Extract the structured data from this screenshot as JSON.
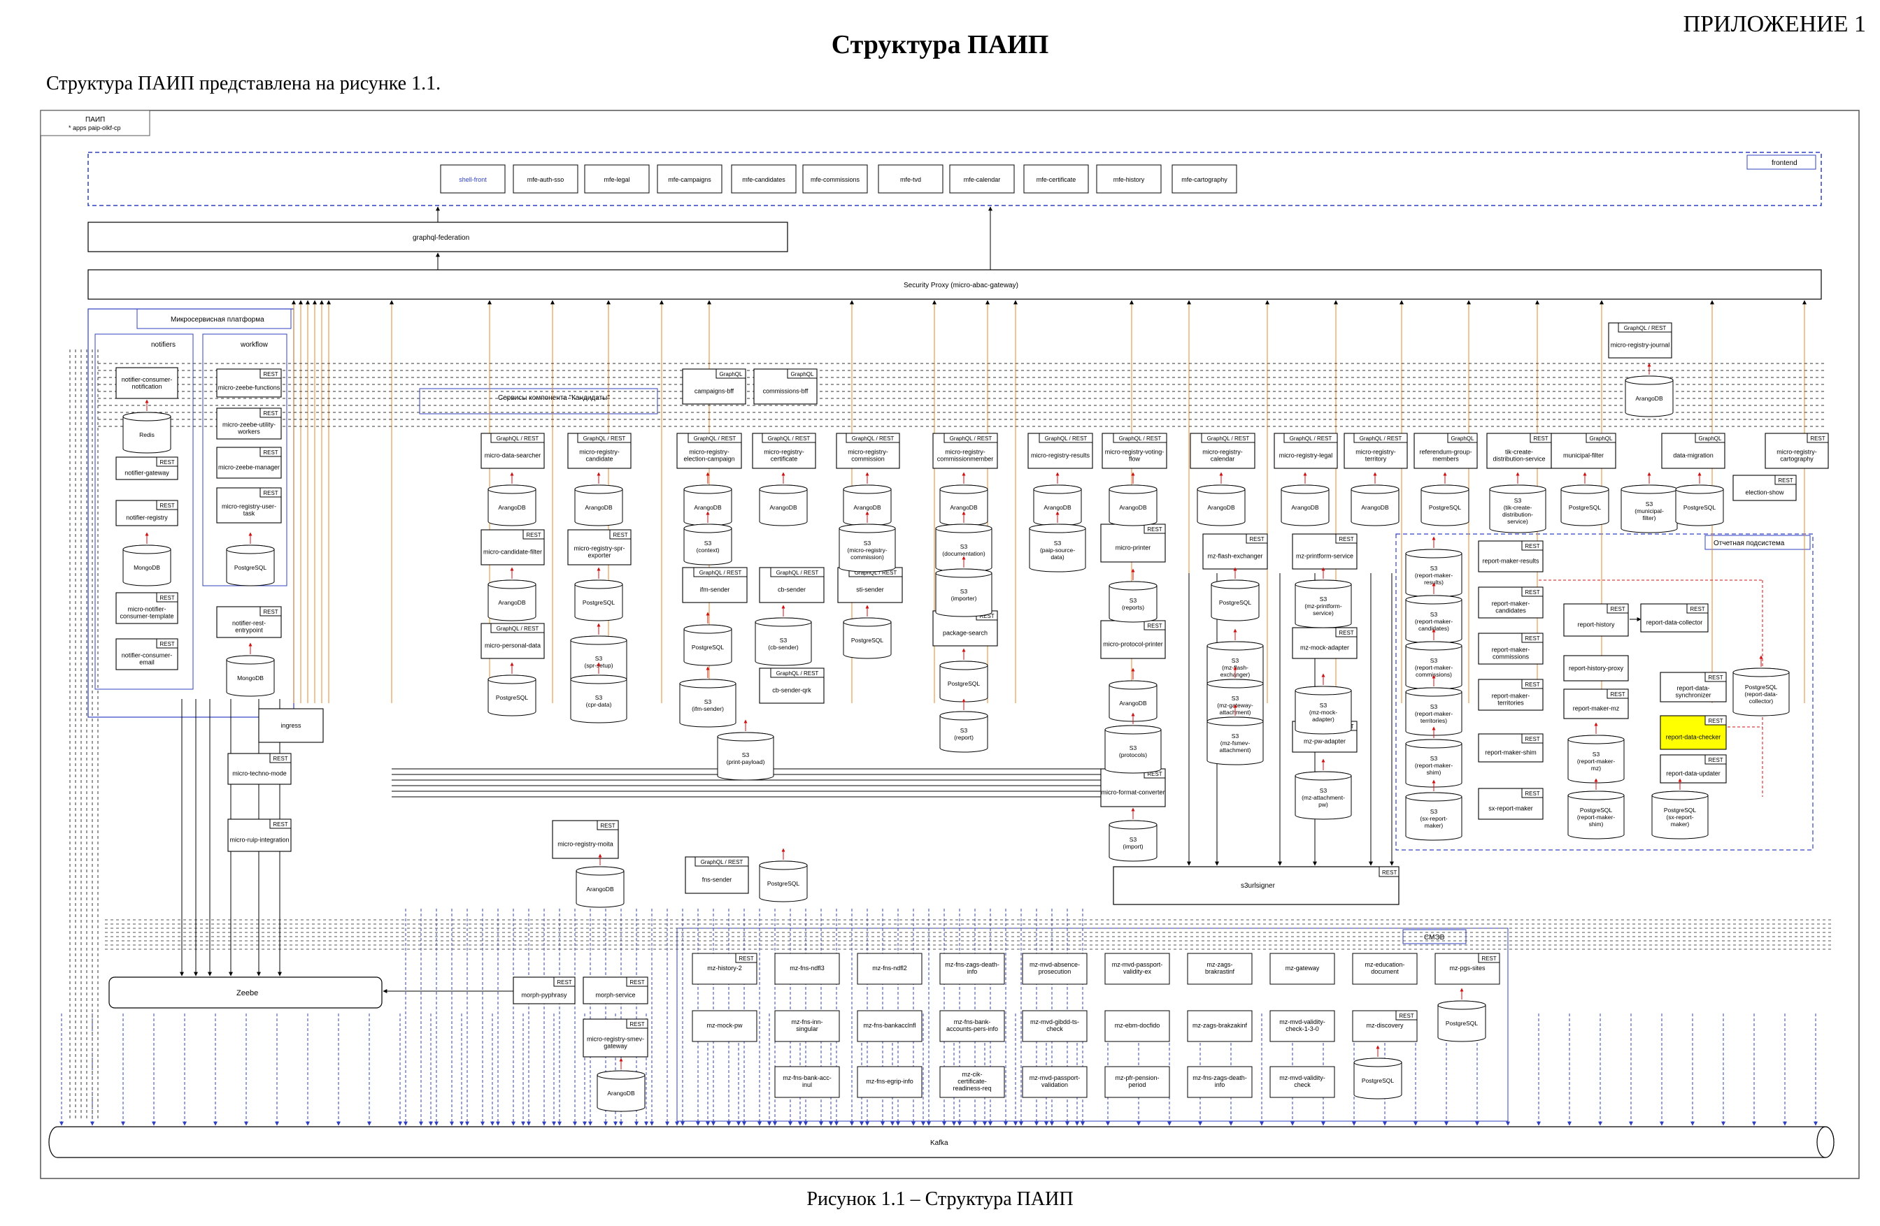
{
  "header": {
    "appendix": "ПРИЛОЖЕНИЕ 1",
    "title": "Структура ПАИП",
    "intro": "Структура ПАИП представлена на рисунке 1.1.",
    "caption": "Рисунок 1.1 – Структура ПАИП"
  },
  "diagram": {
    "corner": [
      "ПАИП",
      "* apps paip-olkf-cp"
    ],
    "frontend": {
      "label": "frontend",
      "apps": [
        "shell-front",
        "mfe-auth-sso",
        "mfe-legal",
        "mfe-campaigns",
        "mfe-candidates",
        "mfe-commissions",
        "mfe-tvd",
        "mfe-calendar",
        "mfe-certificate",
        "mfe-history",
        "mfe-cartography"
      ]
    },
    "federation": "graphql-federation",
    "security_proxy": "Security Proxy (micro-abac-gateway)",
    "platform_label": "Микросервисная платформа",
    "notifiers_label": "notifiers",
    "workflow_label": "workflow",
    "candidates_group_label": "Сервисы компонента \"Кандидаты\"",
    "reporting_label": "Отчетная подсистема",
    "smev_label": "СМЭВ",
    "kafka": "Kafka",
    "zeebe": "Zeebe",
    "s3urlsigner": "s3urlsigner",
    "services": [
      {
        "id": "notifier-consumer-notification",
        "label": "notifier-consumer-notification",
        "tag": ""
      },
      {
        "id": "notifier-gateway",
        "label": "notifier-gateway",
        "tag": "REST"
      },
      {
        "id": "notifier-registry",
        "label": "notifier-registry",
        "tag": "REST"
      },
      {
        "id": "micro-notifier-consumer-template",
        "label": "micro-notifier-consumer-template",
        "tag": "REST"
      },
      {
        "id": "notifier-consumer-email",
        "label": "notifier-consumer-email",
        "tag": "REST"
      },
      {
        "id": "micro-zeebe-functions",
        "label": "micro-zeebe-functions",
        "tag": "REST"
      },
      {
        "id": "micro-zeebe-utility-workers",
        "label": "micro-zeebe-utility-workers",
        "tag": "REST"
      },
      {
        "id": "micro-zeebe-manager",
        "label": "micro-zeebe-manager",
        "tag": "REST"
      },
      {
        "id": "micro-registry-user-task",
        "label": "micro-registry-user-task",
        "tag": "REST"
      },
      {
        "id": "notifier-rest-entrypoint",
        "label": "notifier-rest-entrypoint",
        "tag": "REST"
      },
      {
        "id": "ingress",
        "label": "ingress",
        "tag": ""
      },
      {
        "id": "micro-techno-mode",
        "label": "micro-techno-mode",
        "tag": "REST"
      },
      {
        "id": "micro-ruip-integration",
        "label": "micro-ruip-integration",
        "tag": "REST"
      },
      {
        "id": "campaigns-bff",
        "label": "campaigns-bff",
        "tag": "GraphQL"
      },
      {
        "id": "commissions-bff",
        "label": "commissions-bff",
        "tag": "GraphQL"
      },
      {
        "id": "micro-data-searcher",
        "label": "micro-data-searcher",
        "tag": "GraphQL / REST"
      },
      {
        "id": "micro-registry-candidate",
        "label": "micro-registry-candidate",
        "tag": "GraphQL / REST"
      },
      {
        "id": "micro-registry-election-campaign",
        "label": "micro-registry-election-campaign",
        "tag": "GraphQL / REST"
      },
      {
        "id": "micro-registry-certificate",
        "label": "micro-registry-certificate",
        "tag": "GraphQL / REST"
      },
      {
        "id": "micro-registry-commission",
        "label": "micro-registry-commission",
        "tag": "GraphQL / REST"
      },
      {
        "id": "micro-registry-commissionmember",
        "label": "micro-registry-commissionmember",
        "tag": "GraphQL / REST"
      },
      {
        "id": "micro-registry-results",
        "label": "micro-registry-results",
        "tag": "GraphQL / REST"
      },
      {
        "id": "micro-registry-voting-flow",
        "label": "micro-registry-voting-flow",
        "tag": "GraphQL / REST"
      },
      {
        "id": "micro-registry-calendar",
        "label": "micro-registry-calendar",
        "tag": "GraphQL / REST"
      },
      {
        "id": "micro-registry-legal",
        "label": "micro-registry-legal",
        "tag": "GraphQL / REST"
      },
      {
        "id": "micro-registry-territory",
        "label": "micro-registry-territory",
        "tag": "GraphQL / REST"
      },
      {
        "id": "referendum-group-members",
        "label": "referendum-group-members",
        "tag": "GraphQL"
      },
      {
        "id": "tik-create-distribution-service",
        "label": "tik-create-distribution-service",
        "tag": "REST"
      },
      {
        "id": "municipal-filter",
        "label": "municipal-filter",
        "tag": "GraphQL"
      },
      {
        "id": "data-migration",
        "label": "data-migration",
        "tag": "GraphQL"
      },
      {
        "id": "micro-registry-cartography",
        "label": "micro-registry-cartography",
        "tag": "REST"
      },
      {
        "id": "election-show",
        "label": "election-show",
        "tag": "REST"
      },
      {
        "id": "micro-registry-journal",
        "label": "micro-registry-journal",
        "tag": "GraphQL / REST"
      },
      {
        "id": "micro-candidate-filter",
        "label": "micro-candidate-filter",
        "tag": "REST"
      },
      {
        "id": "micro-registry-spr-exporter",
        "label": "micro-registry-spr-exporter",
        "tag": "REST"
      },
      {
        "id": "micro-personal-data",
        "label": "micro-personal-data",
        "tag": "GraphQL / REST"
      },
      {
        "id": "ifm-sender",
        "label": "ifm-sender",
        "tag": "GraphQL / REST"
      },
      {
        "id": "cb-sender",
        "label": "cb-sender",
        "tag": "GraphQL / REST"
      },
      {
        "id": "sti-sender",
        "label": "sti-sender",
        "tag": "GraphQL / REST"
      },
      {
        "id": "cb-sender-qrk",
        "label": "cb-sender-qrk",
        "tag": "GraphQL / REST"
      },
      {
        "id": "package-search",
        "label": "package-search",
        "tag": "REST"
      },
      {
        "id": "micro-printer",
        "label": "micro-printer",
        "tag": "REST"
      },
      {
        "id": "micro-protocol-printer",
        "label": "micro-protocol-printer",
        "tag": "REST"
      },
      {
        "id": "micro-format-converter",
        "label": "micro-format-converter",
        "tag": "REST"
      },
      {
        "id": "mz-flash-exchanger",
        "label": "mz-flash-exchanger",
        "tag": "REST"
      },
      {
        "id": "mz-printform-service",
        "label": "mz-printform-service",
        "tag": "REST"
      },
      {
        "id": "mz-mock-adapter",
        "label": "mz-mock-adapter",
        "tag": "REST"
      },
      {
        "id": "mz-pw-adapter",
        "label": "mz-pw-adapter",
        "tag": "REST"
      },
      {
        "id": "micro-registry-moita",
        "label": "micro-registry-moita",
        "tag": "REST"
      },
      {
        "id": "fns-sender",
        "label": "fns-sender",
        "tag": "GraphQL / REST"
      },
      {
        "id": "report-maker-results",
        "label": "report-maker-results",
        "tag": "REST"
      },
      {
        "id": "report-maker-candidates",
        "label": "report-maker-candidates",
        "tag": "REST"
      },
      {
        "id": "report-maker-commissions",
        "label": "report-maker-commissions",
        "tag": "REST"
      },
      {
        "id": "report-maker-territories",
        "label": "report-maker-territories",
        "tag": "REST"
      },
      {
        "id": "report-maker-shim",
        "label": "report-maker-shim",
        "tag": "REST"
      },
      {
        "id": "sx-report-maker",
        "label": "sx-report-maker",
        "tag": "REST"
      },
      {
        "id": "report-history",
        "label": "report-history",
        "tag": "REST"
      },
      {
        "id": "report-history-proxy",
        "label": "report-history-proxy",
        "tag": ""
      },
      {
        "id": "report-maker-mz",
        "label": "report-maker-mz",
        "tag": "REST"
      },
      {
        "id": "report-data-collector",
        "label": "report-data-collector",
        "tag": "REST"
      },
      {
        "id": "report-data-synchronizer",
        "label": "report-data-synchronizer",
        "tag": "REST"
      },
      {
        "id": "report-data-checker",
        "label": "report-data-checker",
        "tag": "REST"
      },
      {
        "id": "report-data-updater",
        "label": "report-data-updater",
        "tag": "REST"
      },
      {
        "id": "morph-pyphrasy",
        "label": "morph-pyphrasy",
        "tag": "REST"
      },
      {
        "id": "morph-service",
        "label": "morph-service",
        "tag": "REST"
      },
      {
        "id": "micro-registry-smev-gateway",
        "label": "micro-registry-smev-gateway",
        "tag": "REST"
      }
    ],
    "smev_services": [
      "mz-history-2",
      "mz-fns-ndfl3",
      "mz-fns-ndfl2",
      "mz-fns-zags-death-info",
      "mz-mvd-absence-prosecution",
      "mz-mvd-passport-validity-ex",
      "mz-zags-brakrastinf",
      "mz-gateway",
      "mz-education-document",
      "mz-pgs-sites",
      "mz-mock-pw",
      "mz-fns-inn-singular",
      "mz-fns-bankacclnfl",
      "mz-fns-bank-accounts-pers-info",
      "mz-mvd-gibdd-ts-check",
      "mz-ebm-docfido",
      "mz-zags-brakzakinf",
      "mz-mvd-validity-check-1-3-0",
      "mz-discovery",
      "mz-fns-bank-acc-inul",
      "mz-fns-egrip-info",
      "mz-cik-certificate-readiness-req",
      "mz-mvd-passport-validation",
      "mz-pfr-pension-period",
      "mz-fns-zags-death-info",
      "mz-mvd-validity-check"
    ],
    "storage": [
      "Redis",
      "MongoDB",
      "PostgreSQL",
      "MongoDB",
      "ArangoDB",
      "ArangoDB",
      "ArangoDB",
      "ArangoDB",
      "ArangoDB",
      "ArangoDB",
      "ArangoDB",
      "ArangoDB",
      "ArangoDB",
      "ArangoDB",
      "ArangoDB",
      "PostgreSQL",
      "S3 (tik-create-distribution-service)",
      "PostgreSQL",
      "S3 (municipal-filter)",
      "PostgreSQL",
      "ArangoDB",
      "S3 (context)",
      "S3 (micro-registry-commission)",
      "S3 (documentation)",
      "S3 (paip-source-data)",
      "S3 (importer)",
      "ArangoDB",
      "PostgreSQL",
      "S3 (spr-setup)",
      "S3 (cpr-data)",
      "PostgreSQL",
      "S3 (ifm-sender)",
      "S3 (cb-sender)",
      "PostgreSQL",
      "PostgreSQL",
      "S3 (print-payload)",
      "PostgreSQL",
      "S3 (report)",
      "S3 (reports)",
      "ArangoDB",
      "S3 (protocols)",
      "S3 (import)",
      "PostgreSQL",
      "S3 (mz-flash-exchanger)",
      "S3 (mz-gateway-attachment)",
      "S3 (mz-fsmev-attachment)",
      "S3 (mz-printform-service)",
      "S3 (mz-mock-adapter)",
      "S3 (mz-attachment-pw)",
      "ArangoDB",
      "PostgreSQL",
      "S3 (report-maker-results)",
      "S3 (report-maker-candidates)",
      "S3 (report-maker-commissions)",
      "S3 (report-maker-territories)",
      "S3 (report-maker-shim)",
      "S3 (sx-report-maker)",
      "S3 (report-maker-mz)",
      "PostgreSQL (report-maker-shim)",
      "PostgreSQL (sx-report-maker)",
      "PostgreSQL (report-data-collector)",
      "ArangoDB",
      "PostgreSQL",
      "PostgreSQL"
    ]
  }
}
